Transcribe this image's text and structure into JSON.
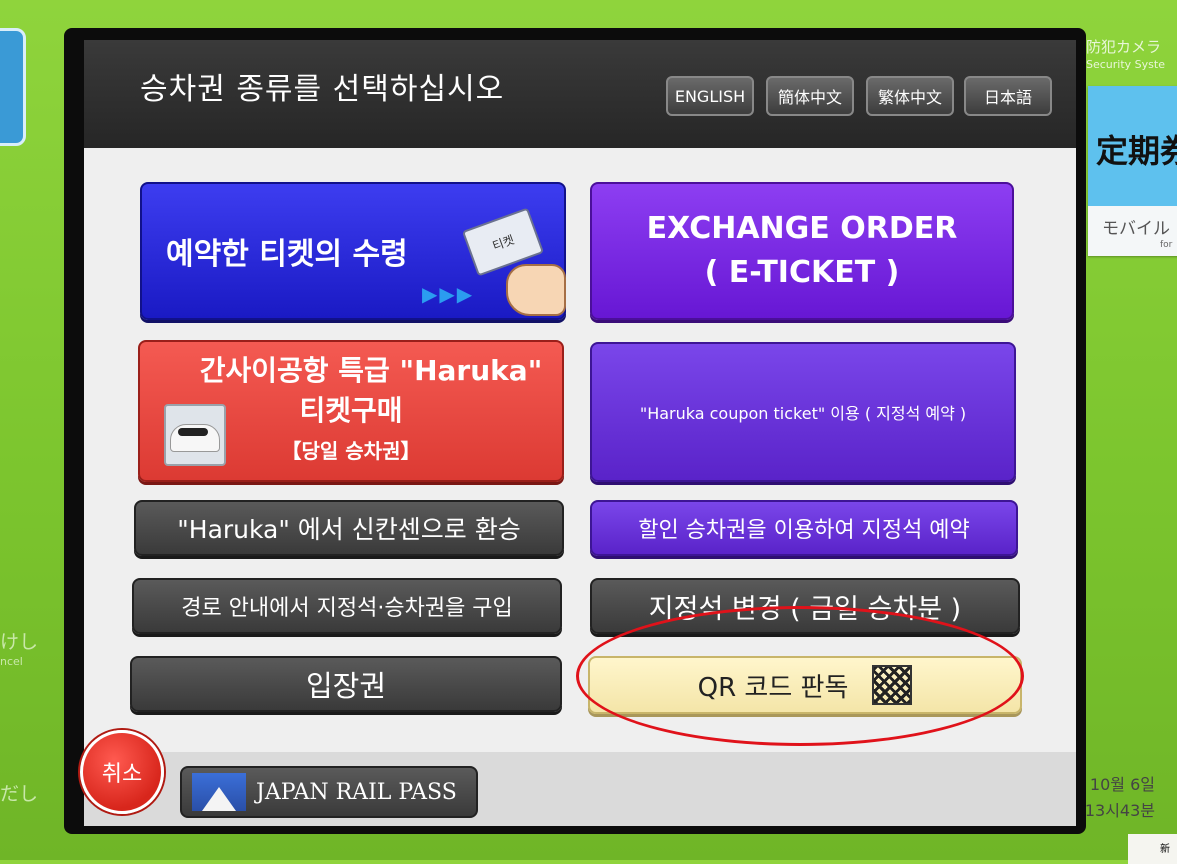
{
  "header": {
    "title": "승차권 종류를 선택하십시오",
    "languages": [
      "ENGLISH",
      "簡体中文",
      "繁体中文",
      "日本語"
    ]
  },
  "menu": {
    "reserved_pickup": "예약한 티켓의 수령",
    "reserved_arrows": "▶▶▶",
    "ticket_card_label": "티켓",
    "exchange_line1": "EXCHANGE ORDER",
    "exchange_line2": "( E-TICKET )",
    "haruka_line1": "간사이공항 특급 \"Haruka\"",
    "haruka_line2": "티켓구매",
    "haruka_line3": "【당일 승차권】",
    "haruka_coupon": "\"Haruka coupon ticket\" 이용 ( 지정석 예약 )",
    "haruka_transfer": "\"Haruka\" 에서 신칸센으로 환승",
    "discount_reserve": "할인 승차권을 이용하여 지정석 예약",
    "route_purchase": "경로 안내에서 지정석·승차권을 구입",
    "change_seat": "지정석 변경 ( 금일 승차분 )",
    "platform_ticket": "입장권",
    "qr_read": "QR 코드 판독"
  },
  "footer": {
    "cancel": "취소",
    "jr_pass": "JAPAN RAIL PASS",
    "date": "10월 6일",
    "time": "13시43분"
  },
  "surroundings": {
    "camera_label": "防犯カメラ",
    "camera_sub": "Security Syste",
    "teiki_label": "定期券",
    "mobile_label": "モバイル",
    "mobile_sub": "for",
    "left_top": "けし",
    "left_top_sub": "ncel",
    "left_bottom": "だし",
    "new_badge": "新"
  },
  "colors": {
    "background": "#7cc52e",
    "blue_button": "#2a2ad8",
    "purple_button": "#7a2ae0",
    "red_button": "#e8473f",
    "highlight_oval": "#e0121a"
  }
}
